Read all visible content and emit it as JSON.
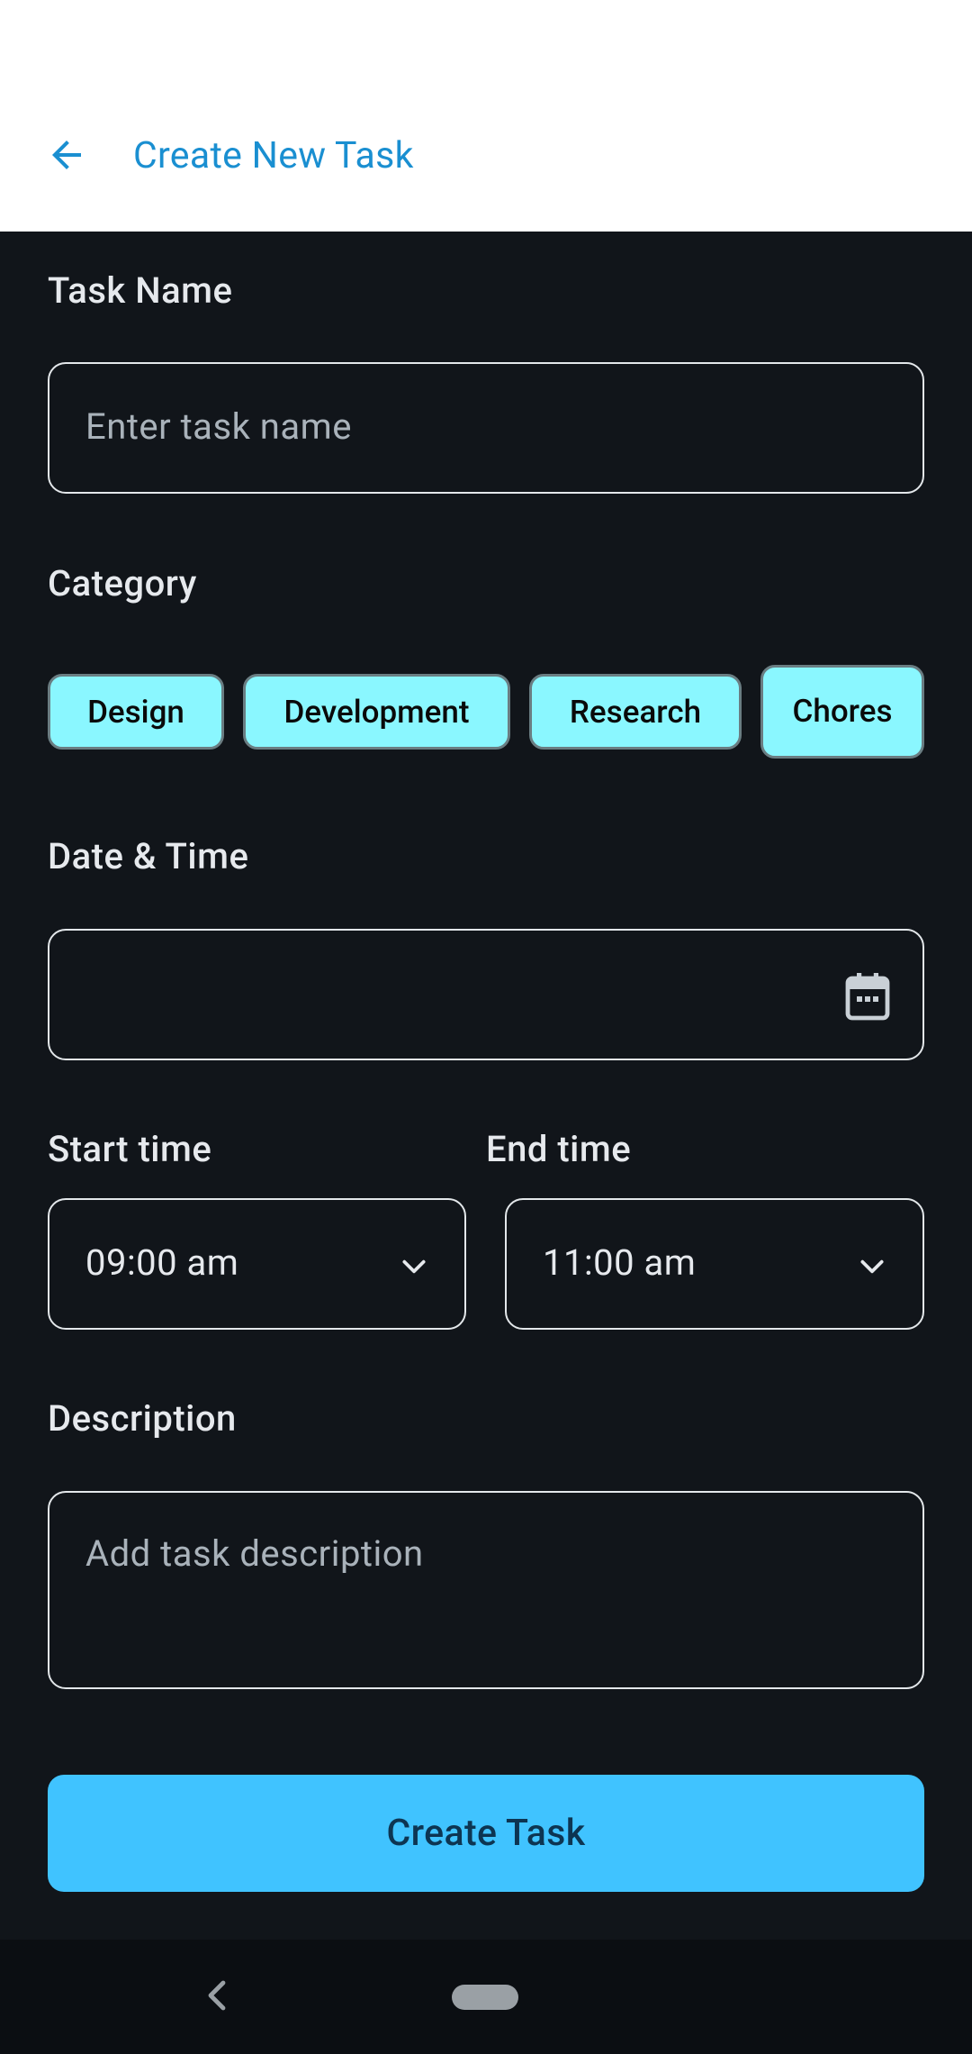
{
  "header": {
    "title": "Create New Task",
    "back_icon": "arrow-back-icon"
  },
  "task_name": {
    "label": "Task Name",
    "placeholder": "Enter task name",
    "value": ""
  },
  "category": {
    "label": "Category",
    "options": [
      "Design",
      "Development",
      "Research",
      "Chores"
    ],
    "chip_color": "#8af7ff"
  },
  "date_time": {
    "label": "Date & Time",
    "value": "",
    "icon": "calendar-icon"
  },
  "start_time": {
    "label": "Start time",
    "value": "09:00 am"
  },
  "end_time": {
    "label": "End time",
    "value": "11:00 am"
  },
  "description": {
    "label": "Description",
    "placeholder": "Add task description",
    "value": ""
  },
  "submit": {
    "label": "Create Task",
    "color": "#40c3ff"
  },
  "colors": {
    "background": "#11151a",
    "accent": "#1a8fd1"
  }
}
